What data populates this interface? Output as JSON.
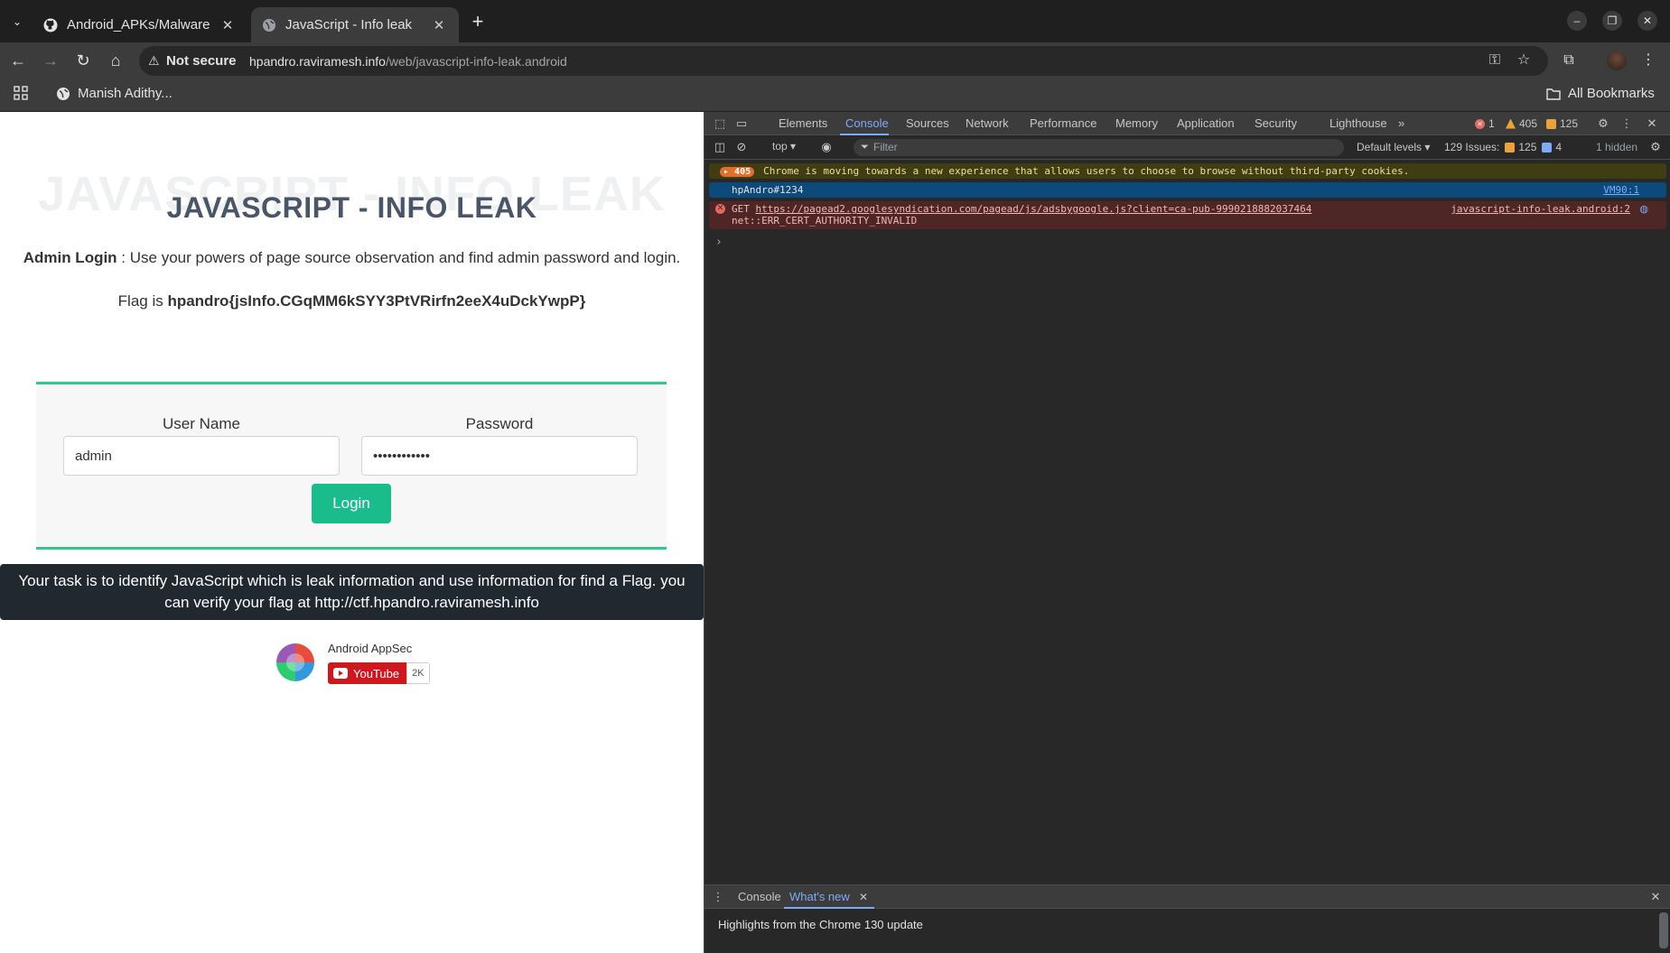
{
  "browser": {
    "tabs": [
      {
        "title": "Android_APKs/Malware",
        "favicon": "github-icon",
        "active": false
      },
      {
        "title": "JavaScript - Info leak",
        "favicon": "globe-icon",
        "active": true
      }
    ],
    "security_label": "Not secure",
    "url_host": "hpandro.raviramesh.info",
    "url_path": "/web/javascript-info-leak.android",
    "bookmarks": [
      {
        "label": "Manish Adithy...",
        "icon": "globe-icon"
      }
    ],
    "all_bookmarks_label": "All Bookmarks"
  },
  "page": {
    "ghost_title": "JAVASCRIPT - INFO LEAK",
    "title": "JAVASCRIPT - INFO LEAK",
    "instruction_bold": "Admin Login",
    "instruction_rest": " : Use your powers of page source observation and find admin password and login.",
    "flag_prefix": "Flag is ",
    "flag_value": "hpandro{jsInfo.CGqMM6kSYY3PtVRirfn2eeX4uDckYwpP}",
    "form": {
      "username_label": "User Name",
      "username_value": "admin",
      "password_label": "Password",
      "password_value": "••••••••••••",
      "login_label": "Login"
    },
    "task_text": "Your task is to identify JavaScript which is leak information and use information for find a Flag. you can verify your flag at http://ctf.hpandro.raviramesh.info",
    "channel": {
      "name": "Android AppSec",
      "youtube_label": "YouTube",
      "subscribers": "2K"
    }
  },
  "devtools": {
    "tabs": [
      "Elements",
      "Console",
      "Sources",
      "Network",
      "Performance",
      "Memory",
      "Application",
      "Security",
      "Lighthouse"
    ],
    "active_tab": "Console",
    "counts": {
      "errors": "1",
      "warnings": "405",
      "issues": "125"
    },
    "context": "top",
    "filter_placeholder": "Filter",
    "levels": "Default levels",
    "issues_summary": "129 Issues:",
    "issues_warn": "125",
    "issues_info": "4",
    "hidden": "1 hidden",
    "messages": {
      "warn_count": "405",
      "warn_text": "Chrome is moving towards a new experience that allows users to choose to browse without third-party cookies.",
      "info_text": "hpAndro#1234",
      "info_source": "VM90:1",
      "err_method": "GET ",
      "err_url": "https://pagead2.googlesyndication.com/pagead/js/adsbygoogle.js?client=ca-pub-9990218882037464",
      "err_detail": "net::ERR_CERT_AUTHORITY_INVALID",
      "err_source": "javascript-info-leak.android:2"
    },
    "drawer": {
      "tabs": [
        "Console",
        "What's new"
      ],
      "active": "What's new",
      "body": "Highlights from the Chrome 130 update"
    }
  }
}
